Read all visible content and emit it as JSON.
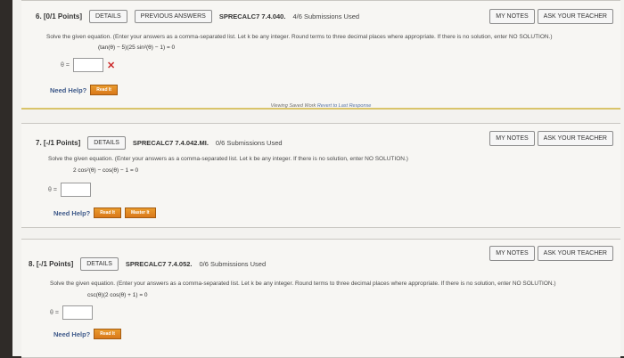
{
  "q6": {
    "points": "6. [0/1 Points]",
    "details": "DETAILS",
    "prev_answers": "PREVIOUS ANSWERS",
    "code": "SPRECALC7 7.4.040.",
    "submissions": "4/6 Submissions Used",
    "my_notes": "MY NOTES",
    "ask_teacher": "ASK YOUR TEACHER",
    "instruction": "Solve the given equation. (Enter your answers as a comma-separated list. Let k be any integer. Round terms to three decimal places where appropriate. If there is no solution, enter NO SOLUTION.)",
    "equation": "(tan(θ) − 5)(25 sin²(θ) − 1) = 0",
    "answer_label": "θ =",
    "answer_value": "",
    "need_help": "Need Help?",
    "read_it": "Read It",
    "viewing_prefix": "Viewing Saved Work",
    "viewing_link": "Revert to Last Response"
  },
  "q7": {
    "points": "7. [-/1 Points]",
    "details": "DETAILS",
    "code": "SPRECALC7 7.4.042.MI.",
    "submissions": "0/6 Submissions Used",
    "my_notes": "MY NOTES",
    "ask_teacher": "ASK YOUR TEACHER",
    "instruction": "Solve the given equation. (Enter your answers as a comma-separated list. Let k be any integer. If there is no solution, enter NO SOLUTION.)",
    "equation": "2 cos²(θ) − cos(θ) − 1 = 0",
    "answer_label": "θ =",
    "answer_value": "",
    "need_help": "Need Help?",
    "read_it": "Read It",
    "master_it": "Master It"
  },
  "q8": {
    "points": "8. [-/1 Points]",
    "details": "DETAILS",
    "code": "SPRECALC7 7.4.052.",
    "submissions": "0/6 Submissions Used",
    "my_notes": "MY NOTES",
    "ask_teacher": "ASK YOUR TEACHER",
    "instruction": "Solve the given equation. (Enter your answers as a comma-separated list. Let k be any integer. Round terms to three decimal places where appropriate. If there is no solution, enter NO SOLUTION.)",
    "equation": "csc(θ)(2 cos(θ) + 1) = 0",
    "answer_label": "θ =",
    "answer_value": "",
    "need_help": "Need Help?",
    "read_it": "Read It"
  }
}
